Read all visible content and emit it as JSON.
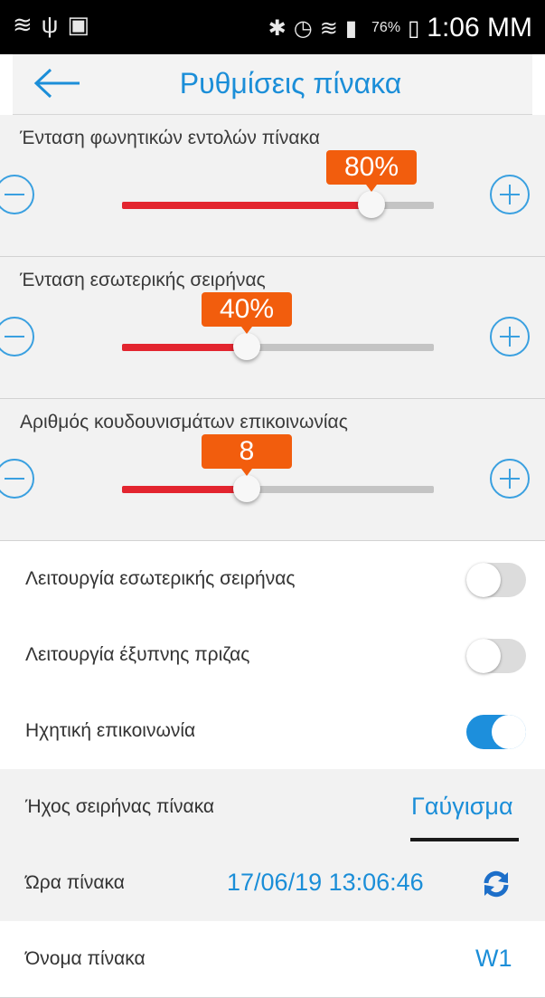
{
  "status_bar": {
    "left_icons": "wifi-icon usb-icon image-icon",
    "battery": "76%",
    "time": "1:06 MM"
  },
  "header": {
    "title": "Ρυθμίσεις πίνακα"
  },
  "sliders": [
    {
      "label": "Ένταση φωνητικών εντολών πίνακα",
      "value_text": "80%",
      "level": 0.8
    },
    {
      "label": "Ένταση εσωτερικής σειρήνας",
      "value_text": "40%",
      "level": 0.4
    },
    {
      "label": "Αριθμός κουδουνισμάτων επικοινωνίας",
      "value_text": "8",
      "level": 0.4
    }
  ],
  "toggles": [
    {
      "label": "Λειτουργία εσωτερικής σειρήνας",
      "on": false
    },
    {
      "label": "Λειτουργία έξυπνης πριζας",
      "on": false
    },
    {
      "label": "Ηχητική επικοινωνία",
      "on": true
    }
  ],
  "siren_sound": {
    "label": "Ήχος σειρήνας πίνακα",
    "value": "Γαύγισμα"
  },
  "panel_time": {
    "label": "Ώρα πίνακα",
    "value": "17/06/19 13:06:46"
  },
  "panel_name": {
    "label": "Όνομα πίνακα",
    "value": "W1"
  },
  "colors": {
    "accent": "#1b8ed8",
    "bubble": "#f25d0d",
    "track_fill": "#e3252f",
    "toggle_on": "#1d8fdc"
  }
}
